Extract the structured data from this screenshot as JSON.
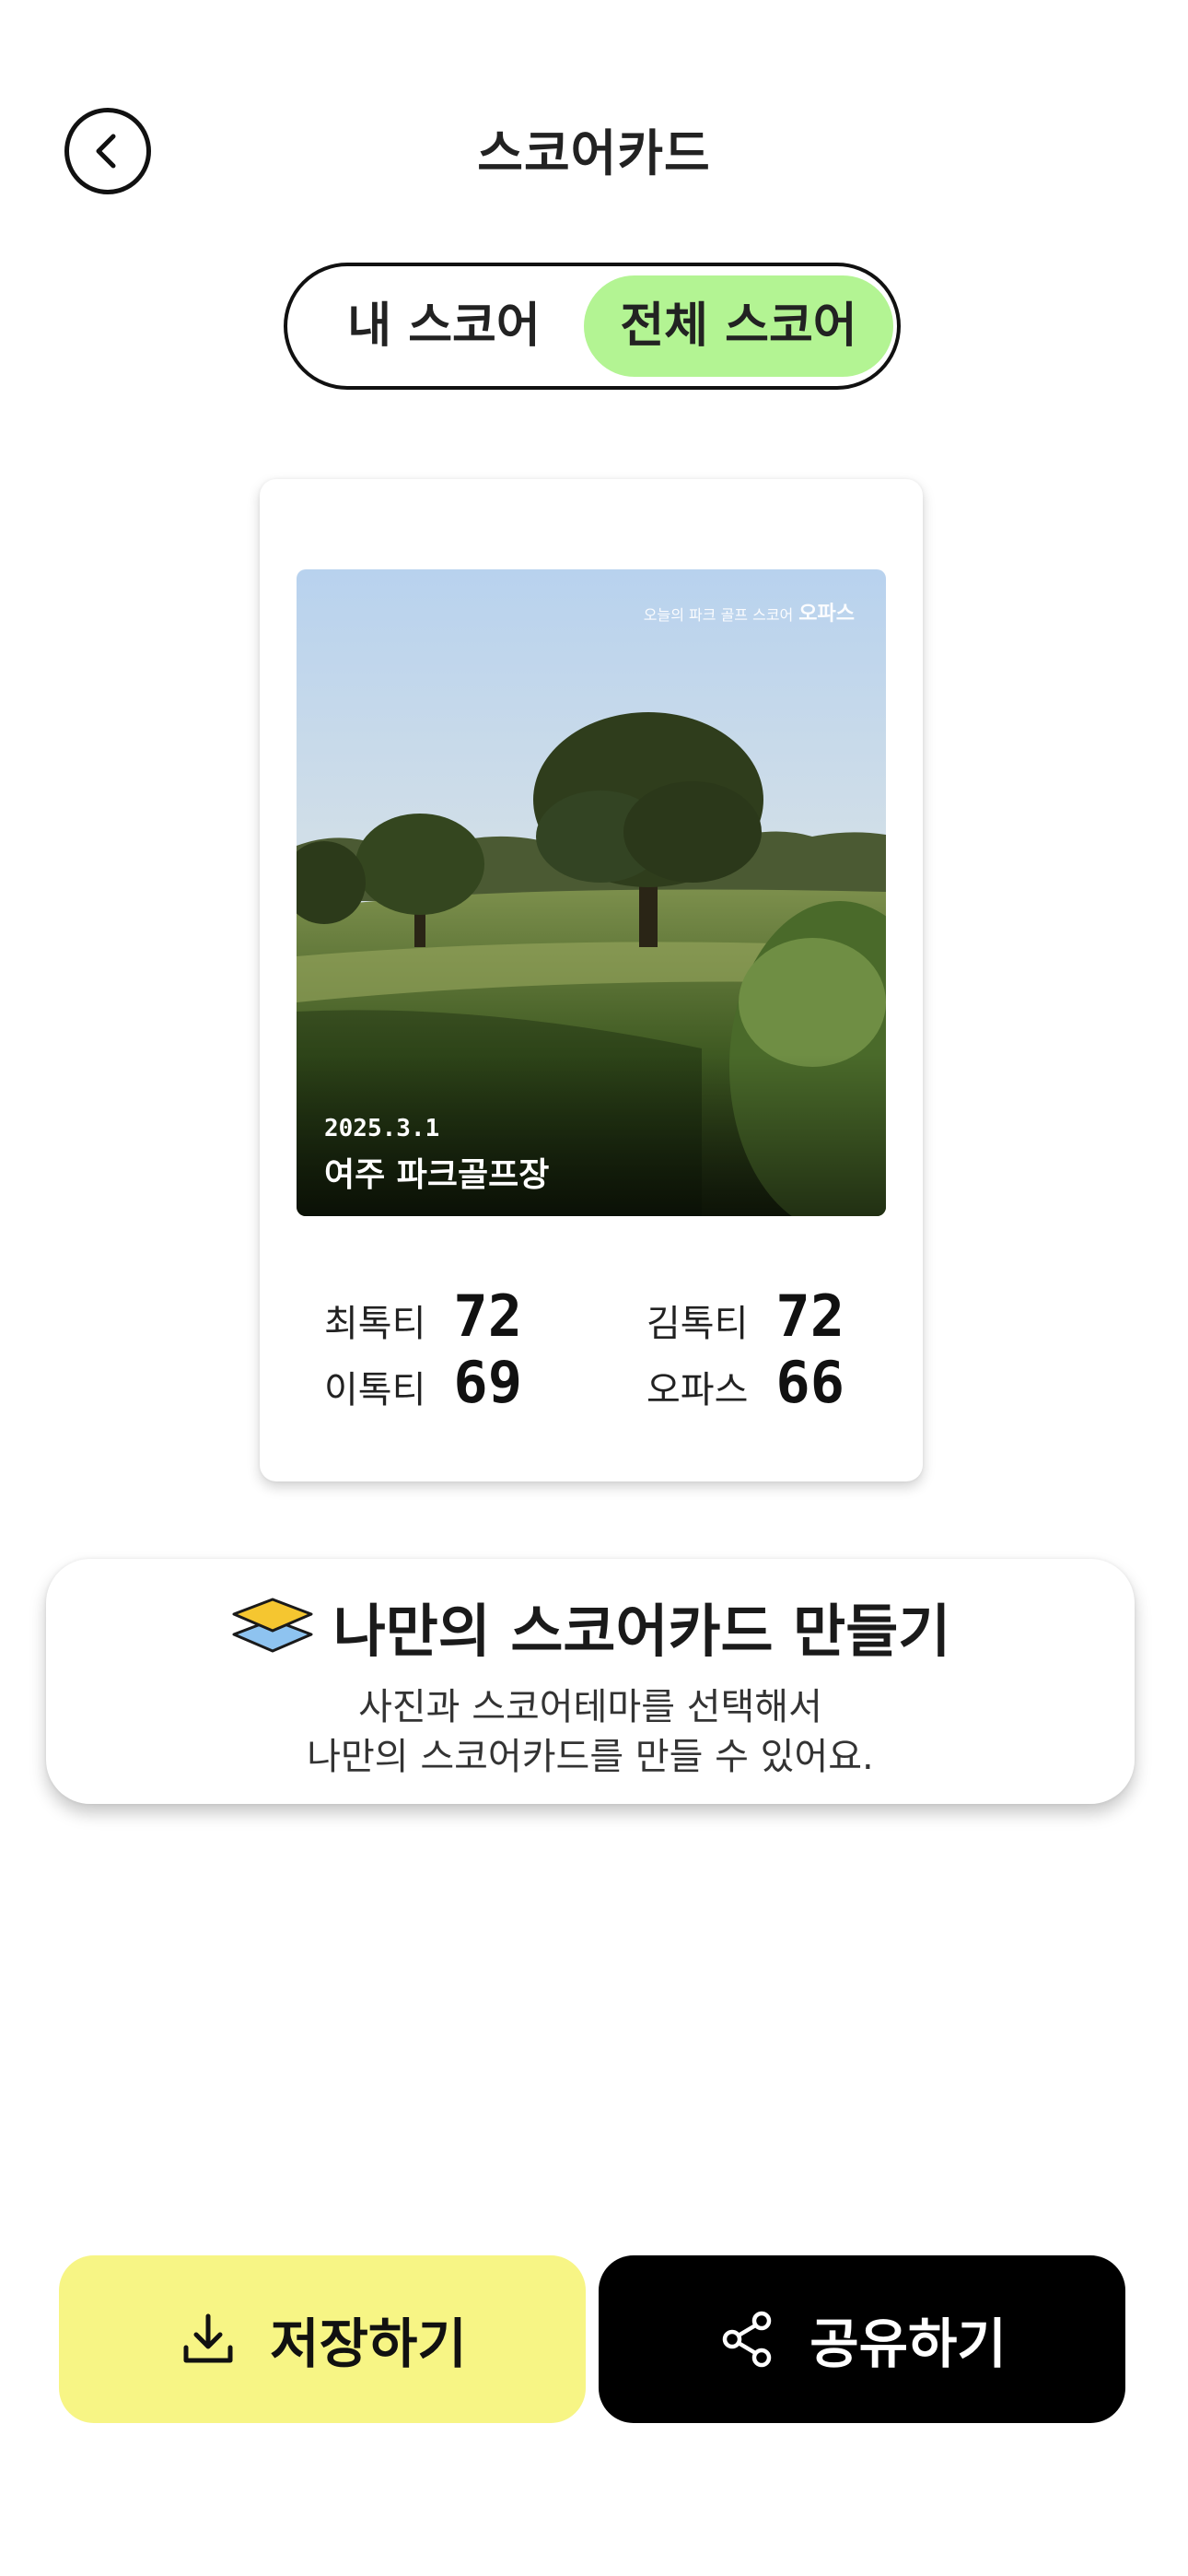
{
  "header": {
    "title": "스코어카드"
  },
  "tabs": [
    {
      "label": "내 스코어",
      "selected": false
    },
    {
      "label": "전체 스코어",
      "selected": true
    }
  ],
  "scorecard": {
    "brand_caption": "오늘의 파크 골프 스코어",
    "brand_name": "오파스",
    "date": "2025.3.1",
    "course": "여주 파크골프장",
    "players": [
      {
        "name": "최톡티",
        "score": "72"
      },
      {
        "name": "김톡티",
        "score": "72"
      },
      {
        "name": "이톡티",
        "score": "69"
      },
      {
        "name": "오파스",
        "score": "66"
      }
    ]
  },
  "promo": {
    "icon": "layers-icon",
    "title": "나만의 스코어카드 만들기",
    "desc_line1": "사진과 스코어테마를 선택해서",
    "desc_line2": "나만의 스코어카드를 만들 수 있어요."
  },
  "actions": {
    "save_label": "저장하기",
    "save_icon": "download-icon",
    "share_label": "공유하기",
    "share_icon": "share-icon"
  },
  "colors": {
    "accent_green": "#b3f493",
    "save_yellow": "#f7f585",
    "share_black": "#000000"
  }
}
